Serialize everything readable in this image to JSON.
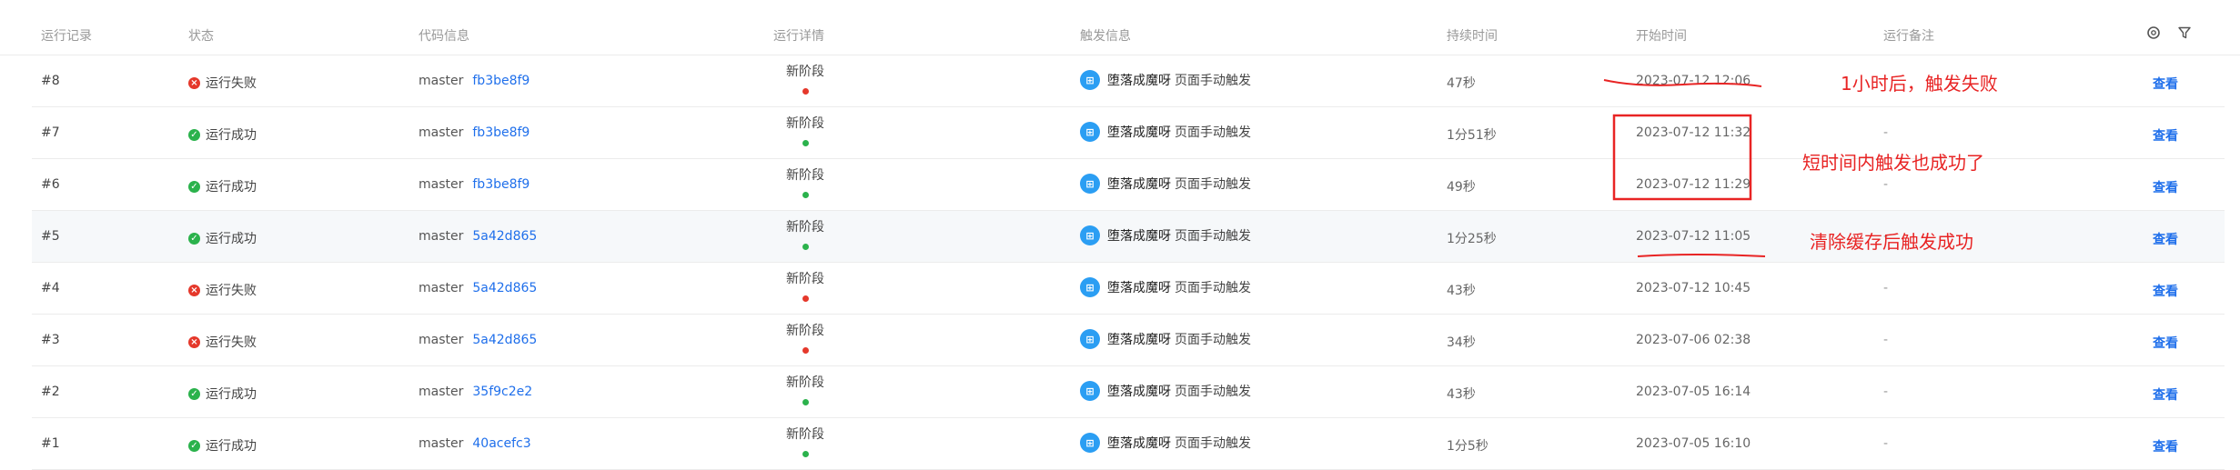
{
  "columns": {
    "run": "运行记录",
    "status": "状态",
    "code": "代码信息",
    "detail": "运行详情",
    "trigger": "触发信息",
    "duration": "持续时间",
    "start": "开始时间",
    "note": "运行备注"
  },
  "rows": [
    {
      "run": "#8",
      "status": "运行失败",
      "ok": false,
      "branch": "master",
      "hash": "fb3be8f9",
      "stage": "新阶段",
      "user": "堕落成魔呀",
      "trigger_text": "页面手动触发",
      "duration": "47秒",
      "start": "2023-07-12 12:06",
      "note": "",
      "view": "查看"
    },
    {
      "run": "#7",
      "status": "运行成功",
      "ok": true,
      "branch": "master",
      "hash": "fb3be8f9",
      "stage": "新阶段",
      "user": "堕落成魔呀",
      "trigger_text": "页面手动触发",
      "duration": "1分51秒",
      "start": "2023-07-12 11:32",
      "note": "-",
      "view": "查看"
    },
    {
      "run": "#6",
      "status": "运行成功",
      "ok": true,
      "branch": "master",
      "hash": "fb3be8f9",
      "stage": "新阶段",
      "user": "堕落成魔呀",
      "trigger_text": "页面手动触发",
      "duration": "49秒",
      "start": "2023-07-12 11:29",
      "note": "-",
      "view": "查看"
    },
    {
      "run": "#5",
      "status": "运行成功",
      "ok": true,
      "branch": "master",
      "hash": "5a42d865",
      "stage": "新阶段",
      "user": "堕落成魔呀",
      "trigger_text": "页面手动触发",
      "duration": "1分25秒",
      "start": "2023-07-12 11:05",
      "note": "-",
      "view": "查看"
    },
    {
      "run": "#4",
      "status": "运行失败",
      "ok": false,
      "branch": "master",
      "hash": "5a42d865",
      "stage": "新阶段",
      "user": "堕落成魔呀",
      "trigger_text": "页面手动触发",
      "duration": "43秒",
      "start": "2023-07-12 10:45",
      "note": "-",
      "view": "查看"
    },
    {
      "run": "#3",
      "status": "运行失败",
      "ok": false,
      "branch": "master",
      "hash": "5a42d865",
      "stage": "新阶段",
      "user": "堕落成魔呀",
      "trigger_text": "页面手动触发",
      "duration": "34秒",
      "start": "2023-07-06 02:38",
      "note": "-",
      "view": "查看"
    },
    {
      "run": "#2",
      "status": "运行成功",
      "ok": true,
      "branch": "master",
      "hash": "35f9c2e2",
      "stage": "新阶段",
      "user": "堕落成魔呀",
      "trigger_text": "页面手动触发",
      "duration": "43秒",
      "start": "2023-07-05 16:14",
      "note": "-",
      "view": "查看"
    },
    {
      "run": "#1",
      "status": "运行成功",
      "ok": true,
      "branch": "master",
      "hash": "40acefc3",
      "stage": "新阶段",
      "user": "堕落成魔呀",
      "trigger_text": "页面手动触发",
      "duration": "1分5秒",
      "start": "2023-07-05 16:10",
      "note": "-",
      "view": "查看"
    }
  ],
  "annotations": {
    "a1": "1小时后，触发失败",
    "a2": "短时间内触发也成功了",
    "a3": "清除缓存后触发成功"
  },
  "colors": {
    "success": "#2bb24c",
    "fail": "#e5382b",
    "link": "#1f6feb",
    "annotation": "#e82424"
  },
  "icons": {
    "settings": "gear-icon",
    "filter": "filter-icon",
    "success": "check-circle-icon",
    "fail": "x-circle-icon"
  },
  "highlighted_row": 3
}
